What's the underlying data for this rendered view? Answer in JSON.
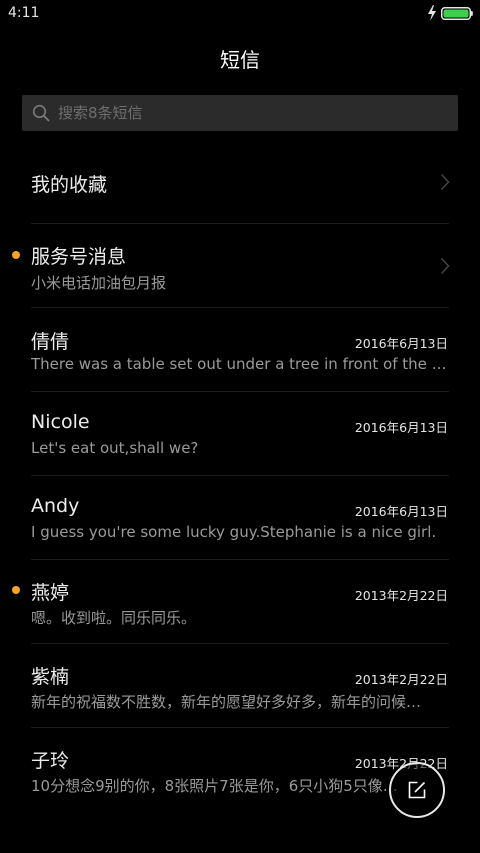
{
  "status_bar": {
    "time": "4:11",
    "battery_color": "#3ccf4e"
  },
  "header": {
    "title": "短信"
  },
  "search": {
    "placeholder": "搜索8条短信",
    "icon": "search-icon"
  },
  "accent_colors": {
    "unread_dot": "#f5a623"
  },
  "entries": [
    {
      "type": "folder",
      "title": "我的收藏",
      "icon": "chevron-right-icon"
    },
    {
      "type": "folder",
      "title": "服务号消息",
      "subtitle": "小米电话加油包月报",
      "unread": true,
      "icon": "chevron-right-icon"
    },
    {
      "type": "conversation",
      "name": "倩倩",
      "date": "2016年6月13日",
      "preview": "There was a table set out under a tree in front of the ho…"
    },
    {
      "type": "conversation",
      "name": "Nicole",
      "date": "2016年6月13日",
      "preview": "Let's eat out,shall we?"
    },
    {
      "type": "conversation",
      "name": "Andy",
      "date": "2016年6月13日",
      "preview": "I guess you're some lucky guy.Stephanie is a nice girl."
    },
    {
      "type": "conversation",
      "name": "燕婷",
      "date": "2013年2月22日",
      "preview": "嗯。收到啦。同乐同乐。",
      "unread": true
    },
    {
      "type": "conversation",
      "name": "紫楠",
      "date": "2013年2月22日",
      "preview": "新年的祝福数不胜数，新年的愿望好多好多，新年的问候…"
    },
    {
      "type": "conversation",
      "name": "子玲",
      "date": "2013年2月22日",
      "preview": "10分想念9别的你，8张照片7张是你，6只小狗5只像…"
    }
  ],
  "fab": {
    "icon": "compose-icon"
  }
}
